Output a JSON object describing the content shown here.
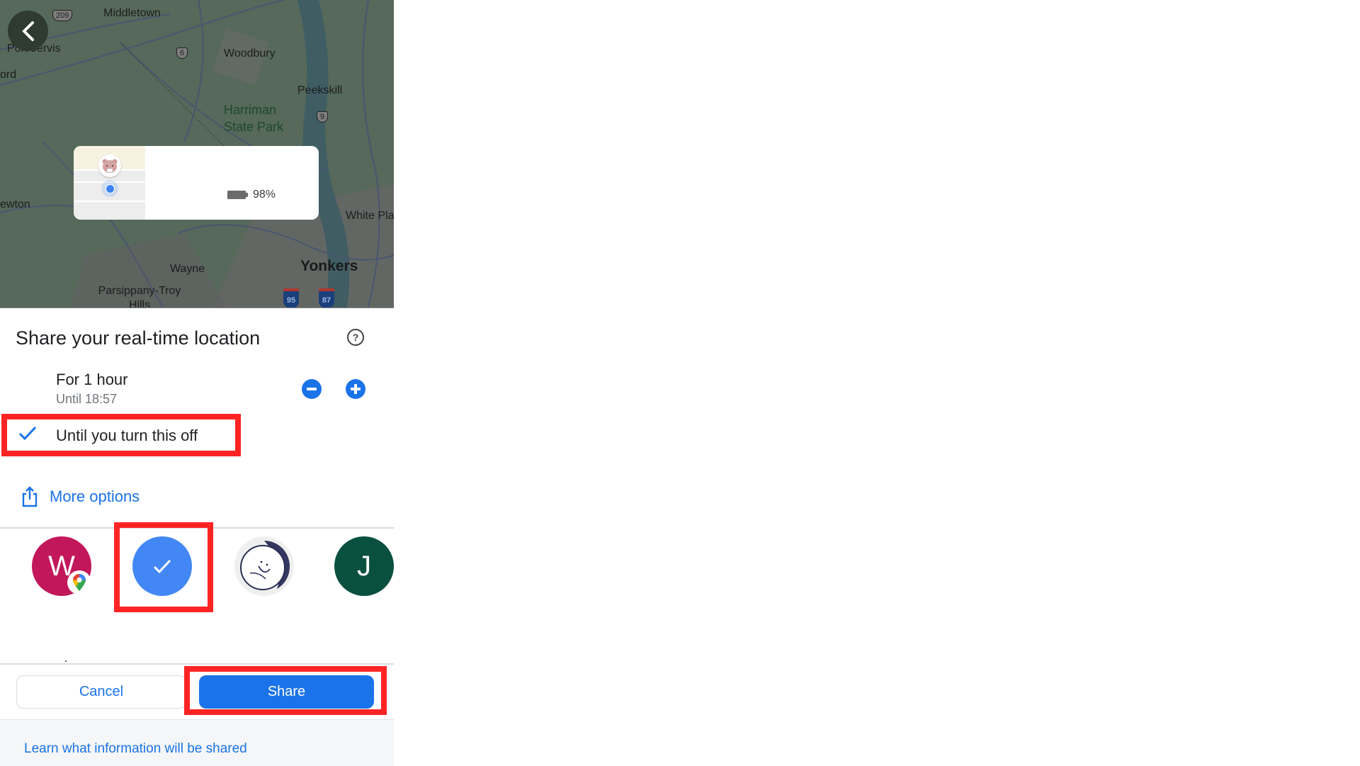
{
  "map": {
    "labels": {
      "middletown": "Middletown",
      "port_jervis": "Port Jervis",
      "ord": "ord",
      "woodbury": "Woodbury",
      "peekskill": "Peekskill",
      "harriman": "Harriman State Park",
      "newton": "ewton",
      "white_plains": "White Pla",
      "wayne": "Wayne",
      "yonkers": "Yonkers",
      "parsippany": "Parsippany-Troy Hills"
    },
    "shields": {
      "us_209": "209",
      "us_6": "6",
      "us_9": "9",
      "i_95": "95",
      "i_87": "87"
    },
    "back_icon": "chevron-left-icon",
    "location_card": {
      "battery_icon": "battery-icon",
      "battery_percent": "98%"
    }
  },
  "sheet": {
    "title": "Share your real-time location",
    "help_icon": "help-circle-icon",
    "help_glyph": "?",
    "duration_options": [
      {
        "label": "For 1 hour",
        "sublabel": "Until 18:57",
        "selected": false
      },
      {
        "label": "Until you turn this off",
        "selected": true
      }
    ],
    "decrease_icon": "minus-circle-icon",
    "increase_icon": "plus-circle-icon",
    "more_options": {
      "label": "More options",
      "icon": "share-icon"
    },
    "contacts": [
      {
        "initial": "W",
        "color": "#c2185b",
        "badge": "google-maps-icon",
        "selected": false
      },
      {
        "initial": "",
        "color": "#4287f5",
        "selected": true
      },
      {
        "initial": "",
        "color": "#efefef",
        "image": "drawn-face-avatar",
        "selected": false
      },
      {
        "initial": "J",
        "color": "#0a5040",
        "selected": false
      }
    ],
    "cancel_label": "Cancel",
    "share_label": "Share",
    "footer_link": "Learn what information will be shared"
  },
  "colors": {
    "accent": "#1a73e8",
    "highlight": "#ff2424",
    "selected_avatar": "#4287f5"
  }
}
